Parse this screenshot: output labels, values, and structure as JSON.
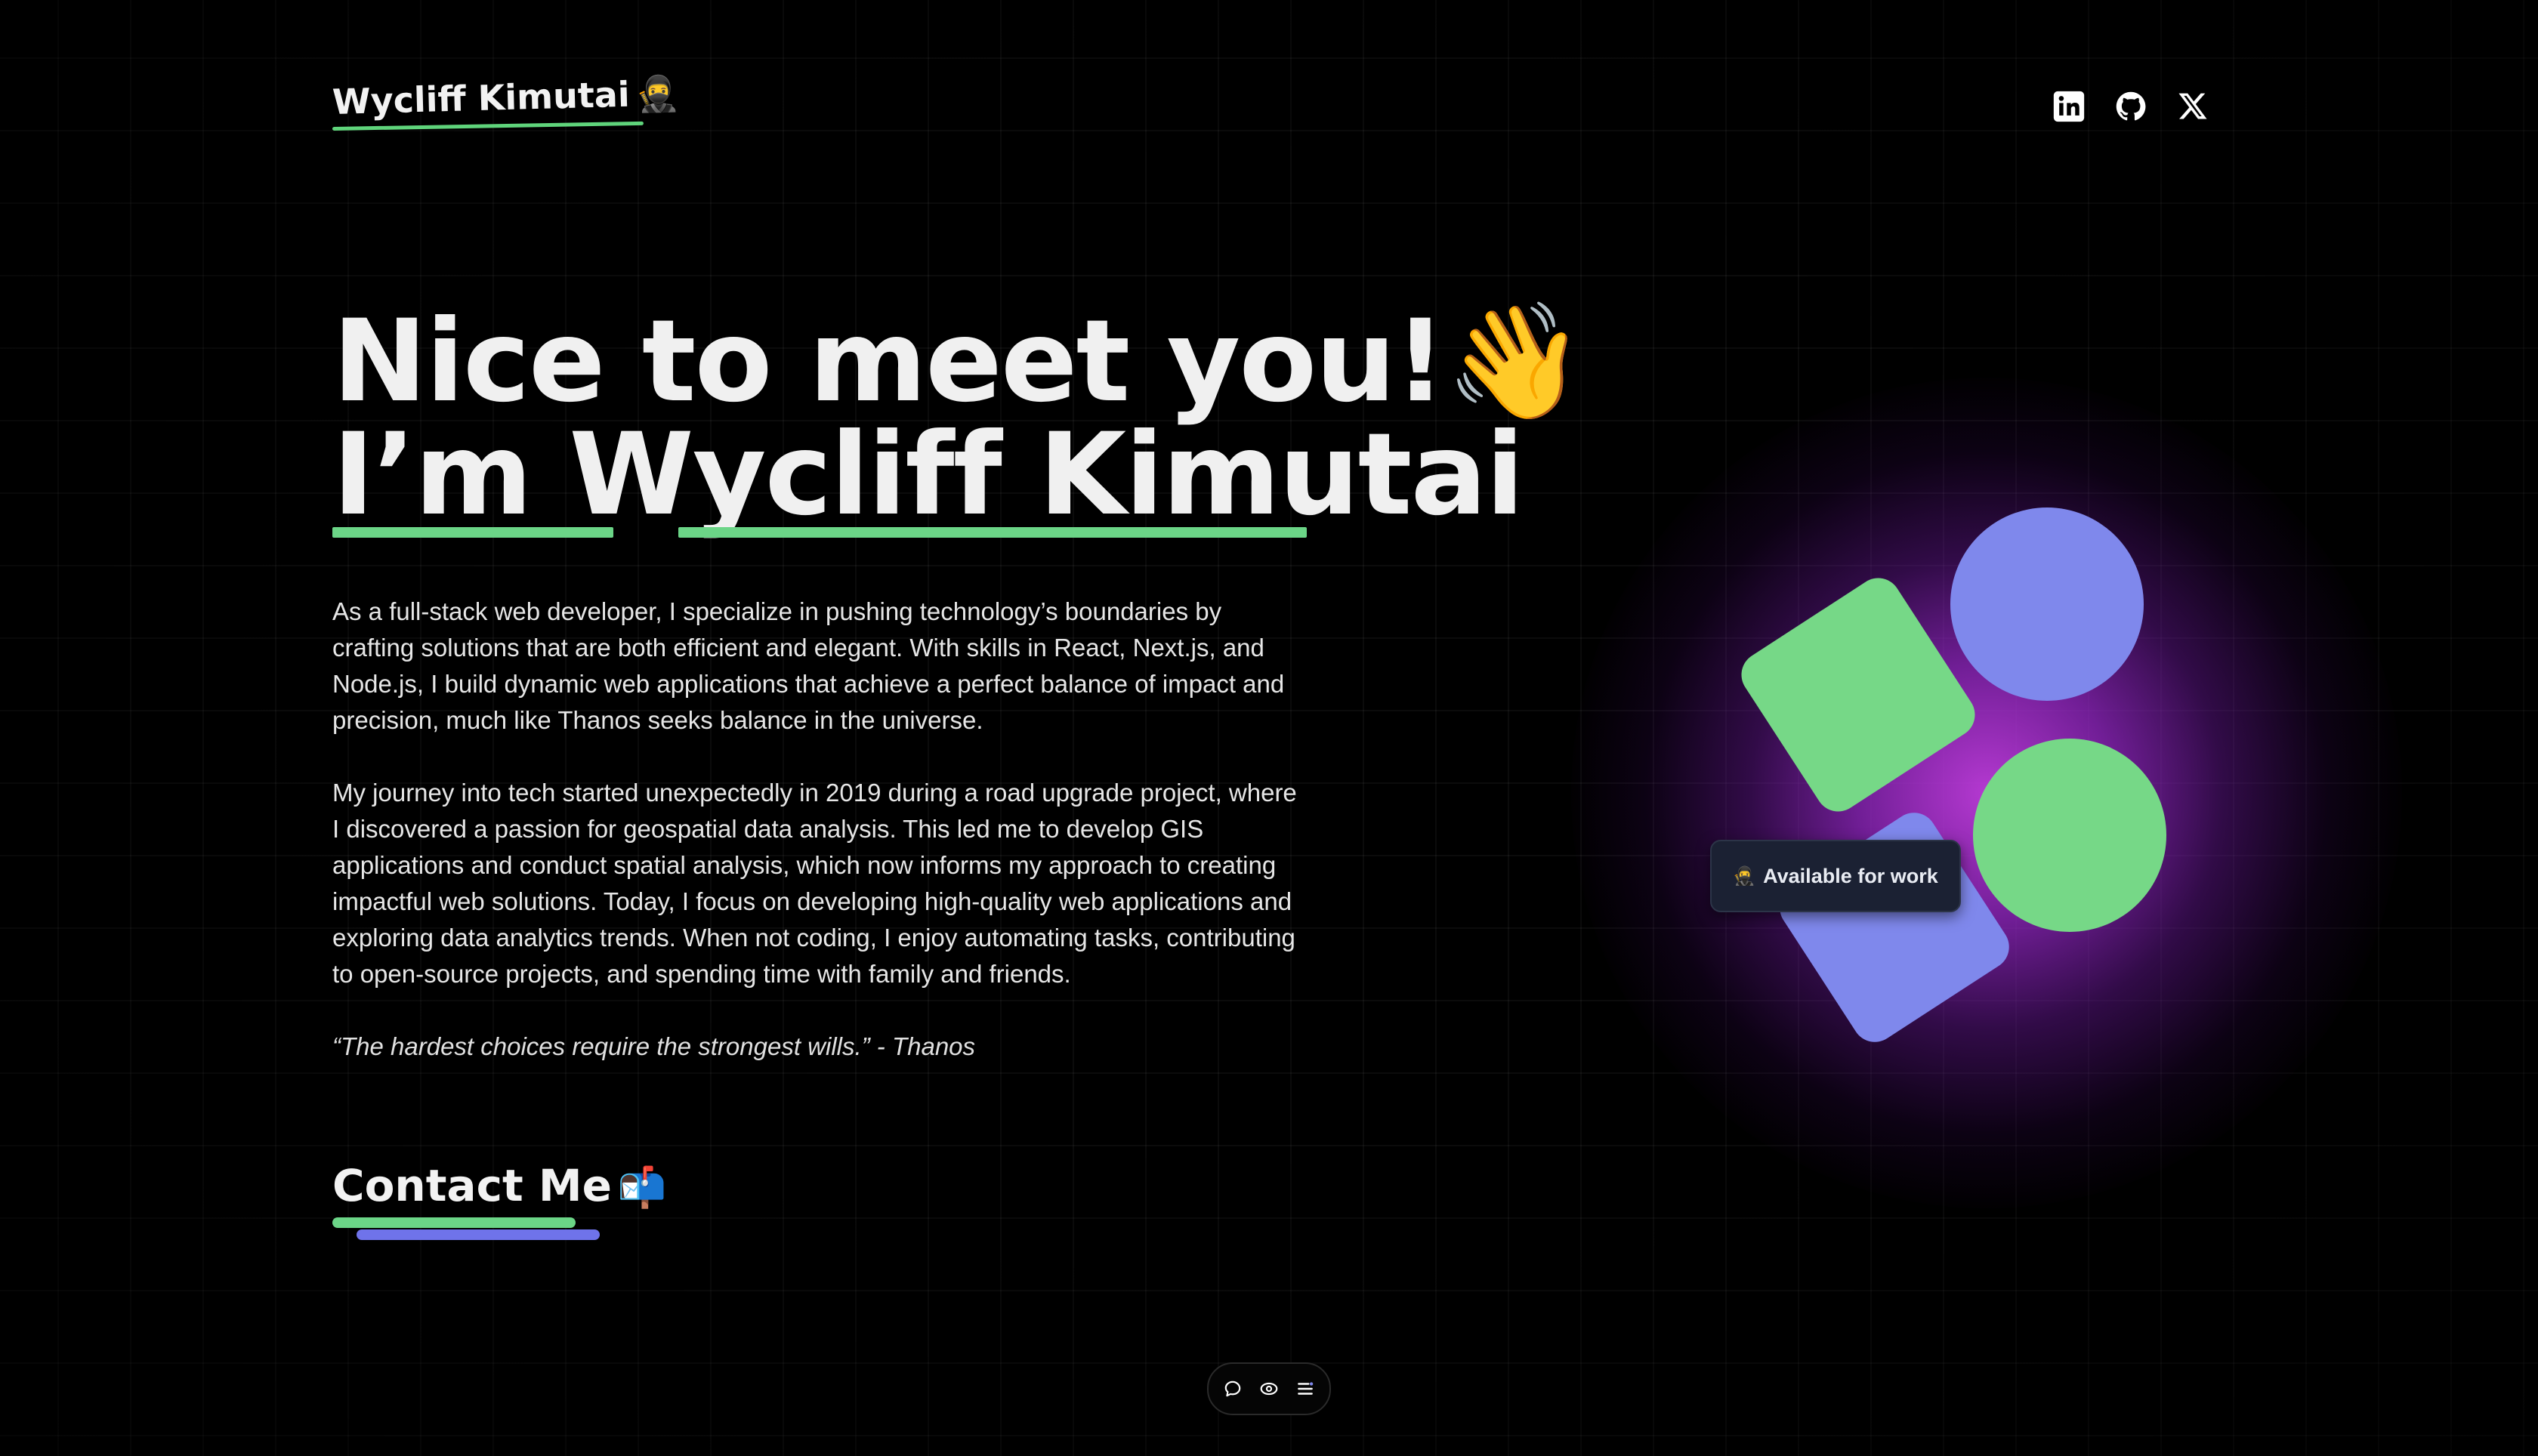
{
  "header": {
    "brand_name": "Wycliff Kimutai",
    "brand_emoji": "🥷",
    "socials": [
      {
        "name": "linkedin-icon"
      },
      {
        "name": "github-icon"
      },
      {
        "name": "x-icon"
      }
    ]
  },
  "hero": {
    "headline_line1": "Nice to meet you!👋",
    "headline_line2": "I’m Wycliff Kimutai",
    "bio_paragraph1": "As a full-stack web developer, I specialize in pushing technology’s boundaries by crafting solutions that are both efficient and elegant. With skills in React, Next.js, and Node.js, I build dynamic web applications that achieve a perfect balance of impact and precision, much like Thanos seeks balance in the universe.",
    "bio_paragraph2": "My journey into tech started unexpectedly in 2019 during a road upgrade project, where I discovered a passion for geospatial data analysis. This led me to develop GIS applications and conduct spatial analysis, which now informs my approach to creating impactful web solutions. Today, I focus on developing high-quality web applications and exploring data analytics trends. When not coding, I enjoy automating tasks, contributing to open-source projects, and spending time with family and friends.",
    "quote": "“The hardest choices require the strongest wills.” - Thanos",
    "contact_label": "Contact Me",
    "contact_emoji": "📬"
  },
  "graphic": {
    "badge_icon": "🥷",
    "badge_text": "Available for work"
  },
  "dock": {
    "items": [
      "chat-bubble-icon",
      "eye-icon",
      "list-icon"
    ]
  },
  "colors": {
    "background": "#000000",
    "accent_green": "#76d887",
    "accent_blue": "#7f88ec",
    "glow_purple": "#be3cdc"
  }
}
